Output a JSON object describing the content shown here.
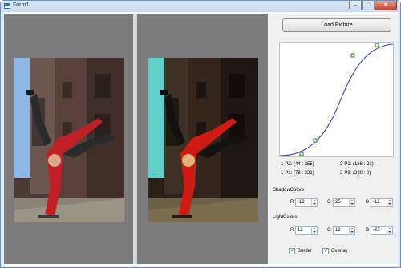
{
  "window": {
    "title": "Form1",
    "buttons": {
      "minimize": "–",
      "maximize": "□",
      "close": "✕"
    }
  },
  "panel": {
    "load_button": "Load Picture",
    "curve": {
      "curve_color": "#3333cc",
      "handle_color": "#1a8a1a",
      "label_p1p2": "1-P2: (44 : 255)",
      "label_2p2": "2-P2: (166 : 23)",
      "label_p1p3": "1-P3: (78 : 221)",
      "label_2p3": "2-P3: (220 : 0)"
    },
    "shadow": {
      "label": "ShadowColors",
      "r_label": "R",
      "r_value": "-12",
      "g_label": "G",
      "g_value": "25",
      "b_label": "B",
      "b_value": "-12"
    },
    "light": {
      "label": "LightColors",
      "r_label": "R",
      "r_value": "12",
      "g_label": "G",
      "g_value": "12",
      "b_label": "B",
      "b_value": "-25"
    },
    "border_label": "Border",
    "border_checked": true,
    "overlay_label": "Overlay",
    "overlay_checked": true
  },
  "colors": {
    "pane_bg": "#7c7c7c",
    "shirt_red": "#c21f26",
    "sky_original": "#8fb7e6",
    "sky_processed": "#5fd0c9"
  }
}
